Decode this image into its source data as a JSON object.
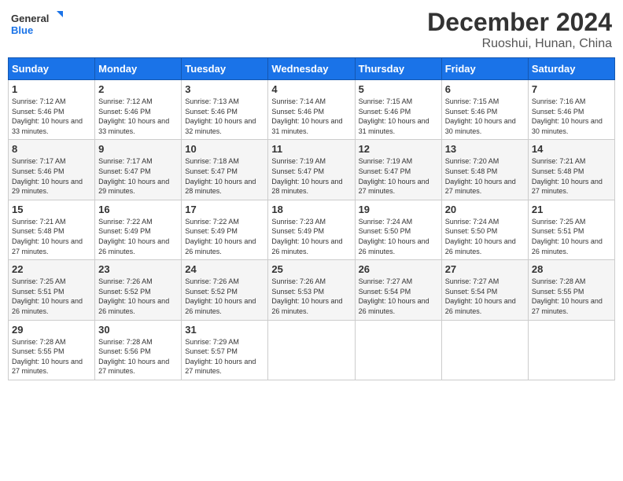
{
  "logo": {
    "line1": "General",
    "line2": "Blue"
  },
  "title": "December 2024",
  "location": "Ruoshui, Hunan, China",
  "weekdays": [
    "Sunday",
    "Monday",
    "Tuesday",
    "Wednesday",
    "Thursday",
    "Friday",
    "Saturday"
  ],
  "weeks": [
    [
      {
        "day": "1",
        "sunrise": "7:12 AM",
        "sunset": "5:46 PM",
        "daylight": "10 hours and 33 minutes."
      },
      {
        "day": "2",
        "sunrise": "7:12 AM",
        "sunset": "5:46 PM",
        "daylight": "10 hours and 33 minutes."
      },
      {
        "day": "3",
        "sunrise": "7:13 AM",
        "sunset": "5:46 PM",
        "daylight": "10 hours and 32 minutes."
      },
      {
        "day": "4",
        "sunrise": "7:14 AM",
        "sunset": "5:46 PM",
        "daylight": "10 hours and 31 minutes."
      },
      {
        "day": "5",
        "sunrise": "7:15 AM",
        "sunset": "5:46 PM",
        "daylight": "10 hours and 31 minutes."
      },
      {
        "day": "6",
        "sunrise": "7:15 AM",
        "sunset": "5:46 PM",
        "daylight": "10 hours and 30 minutes."
      },
      {
        "day": "7",
        "sunrise": "7:16 AM",
        "sunset": "5:46 PM",
        "daylight": "10 hours and 30 minutes."
      }
    ],
    [
      {
        "day": "8",
        "sunrise": "7:17 AM",
        "sunset": "5:46 PM",
        "daylight": "10 hours and 29 minutes."
      },
      {
        "day": "9",
        "sunrise": "7:17 AM",
        "sunset": "5:47 PM",
        "daylight": "10 hours and 29 minutes."
      },
      {
        "day": "10",
        "sunrise": "7:18 AM",
        "sunset": "5:47 PM",
        "daylight": "10 hours and 28 minutes."
      },
      {
        "day": "11",
        "sunrise": "7:19 AM",
        "sunset": "5:47 PM",
        "daylight": "10 hours and 28 minutes."
      },
      {
        "day": "12",
        "sunrise": "7:19 AM",
        "sunset": "5:47 PM",
        "daylight": "10 hours and 27 minutes."
      },
      {
        "day": "13",
        "sunrise": "7:20 AM",
        "sunset": "5:48 PM",
        "daylight": "10 hours and 27 minutes."
      },
      {
        "day": "14",
        "sunrise": "7:21 AM",
        "sunset": "5:48 PM",
        "daylight": "10 hours and 27 minutes."
      }
    ],
    [
      {
        "day": "15",
        "sunrise": "7:21 AM",
        "sunset": "5:48 PM",
        "daylight": "10 hours and 27 minutes."
      },
      {
        "day": "16",
        "sunrise": "7:22 AM",
        "sunset": "5:49 PM",
        "daylight": "10 hours and 26 minutes."
      },
      {
        "day": "17",
        "sunrise": "7:22 AM",
        "sunset": "5:49 PM",
        "daylight": "10 hours and 26 minutes."
      },
      {
        "day": "18",
        "sunrise": "7:23 AM",
        "sunset": "5:49 PM",
        "daylight": "10 hours and 26 minutes."
      },
      {
        "day": "19",
        "sunrise": "7:24 AM",
        "sunset": "5:50 PM",
        "daylight": "10 hours and 26 minutes."
      },
      {
        "day": "20",
        "sunrise": "7:24 AM",
        "sunset": "5:50 PM",
        "daylight": "10 hours and 26 minutes."
      },
      {
        "day": "21",
        "sunrise": "7:25 AM",
        "sunset": "5:51 PM",
        "daylight": "10 hours and 26 minutes."
      }
    ],
    [
      {
        "day": "22",
        "sunrise": "7:25 AM",
        "sunset": "5:51 PM",
        "daylight": "10 hours and 26 minutes."
      },
      {
        "day": "23",
        "sunrise": "7:26 AM",
        "sunset": "5:52 PM",
        "daylight": "10 hours and 26 minutes."
      },
      {
        "day": "24",
        "sunrise": "7:26 AM",
        "sunset": "5:52 PM",
        "daylight": "10 hours and 26 minutes."
      },
      {
        "day": "25",
        "sunrise": "7:26 AM",
        "sunset": "5:53 PM",
        "daylight": "10 hours and 26 minutes."
      },
      {
        "day": "26",
        "sunrise": "7:27 AM",
        "sunset": "5:54 PM",
        "daylight": "10 hours and 26 minutes."
      },
      {
        "day": "27",
        "sunrise": "7:27 AM",
        "sunset": "5:54 PM",
        "daylight": "10 hours and 26 minutes."
      },
      {
        "day": "28",
        "sunrise": "7:28 AM",
        "sunset": "5:55 PM",
        "daylight": "10 hours and 27 minutes."
      }
    ],
    [
      {
        "day": "29",
        "sunrise": "7:28 AM",
        "sunset": "5:55 PM",
        "daylight": "10 hours and 27 minutes."
      },
      {
        "day": "30",
        "sunrise": "7:28 AM",
        "sunset": "5:56 PM",
        "daylight": "10 hours and 27 minutes."
      },
      {
        "day": "31",
        "sunrise": "7:29 AM",
        "sunset": "5:57 PM",
        "daylight": "10 hours and 27 minutes."
      },
      null,
      null,
      null,
      null
    ]
  ]
}
